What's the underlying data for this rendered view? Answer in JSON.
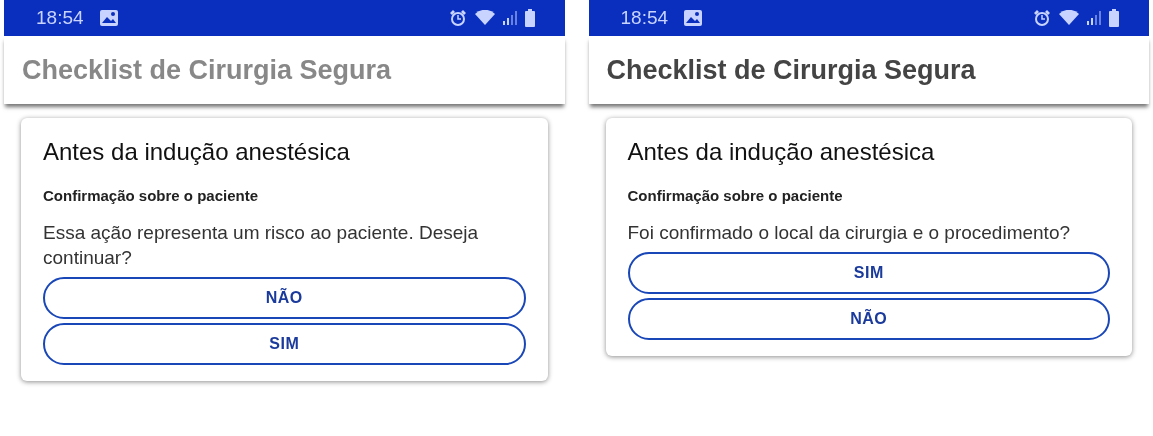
{
  "screens": [
    {
      "status_bar": {
        "time": "18:54"
      },
      "title": "Checklist de Cirurgia Segura",
      "title_dimmed": true,
      "card": {
        "heading": "Antes da indução anestésica",
        "subheading": "Confirmação sobre o paciente",
        "message": "Essa ação representa um risco ao paciente. Deseja continuar?",
        "buttons": [
          "NÃO",
          "SIM"
        ]
      }
    },
    {
      "status_bar": {
        "time": "18:54"
      },
      "title": "Checklist de Cirurgia Segura",
      "title_dimmed": false,
      "card": {
        "heading": "Antes da indução anestésica",
        "subheading": "Confirmação sobre o paciente",
        "message": "Foi confirmado o local da cirurgia e o procedimento?",
        "buttons": [
          "SIM",
          "NÃO"
        ]
      }
    }
  ]
}
